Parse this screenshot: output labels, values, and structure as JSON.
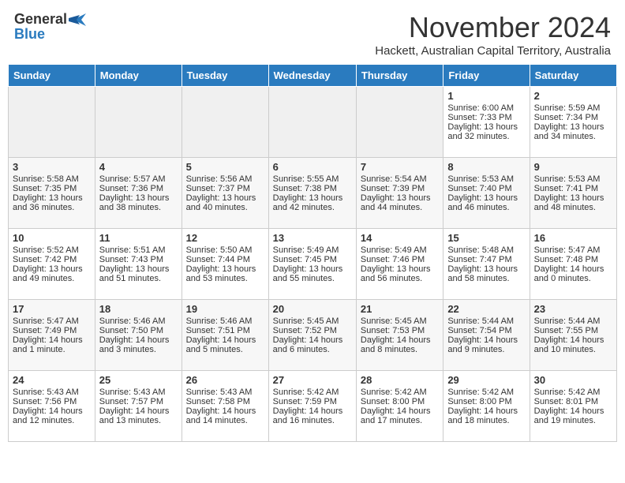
{
  "header": {
    "logo_general": "General",
    "logo_blue": "Blue",
    "month_title": "November 2024",
    "location": "Hackett, Australian Capital Territory, Australia"
  },
  "weekdays": [
    "Sunday",
    "Monday",
    "Tuesday",
    "Wednesday",
    "Thursday",
    "Friday",
    "Saturday"
  ],
  "weeks": [
    [
      {
        "day": "",
        "empty": true
      },
      {
        "day": "",
        "empty": true
      },
      {
        "day": "",
        "empty": true
      },
      {
        "day": "",
        "empty": true
      },
      {
        "day": "",
        "empty": true
      },
      {
        "day": "1",
        "sunrise": "Sunrise: 6:00 AM",
        "sunset": "Sunset: 7:33 PM",
        "daylight": "Daylight: 13 hours and 32 minutes."
      },
      {
        "day": "2",
        "sunrise": "Sunrise: 5:59 AM",
        "sunset": "Sunset: 7:34 PM",
        "daylight": "Daylight: 13 hours and 34 minutes."
      }
    ],
    [
      {
        "day": "3",
        "sunrise": "Sunrise: 5:58 AM",
        "sunset": "Sunset: 7:35 PM",
        "daylight": "Daylight: 13 hours and 36 minutes."
      },
      {
        "day": "4",
        "sunrise": "Sunrise: 5:57 AM",
        "sunset": "Sunset: 7:36 PM",
        "daylight": "Daylight: 13 hours and 38 minutes."
      },
      {
        "day": "5",
        "sunrise": "Sunrise: 5:56 AM",
        "sunset": "Sunset: 7:37 PM",
        "daylight": "Daylight: 13 hours and 40 minutes."
      },
      {
        "day": "6",
        "sunrise": "Sunrise: 5:55 AM",
        "sunset": "Sunset: 7:38 PM",
        "daylight": "Daylight: 13 hours and 42 minutes."
      },
      {
        "day": "7",
        "sunrise": "Sunrise: 5:54 AM",
        "sunset": "Sunset: 7:39 PM",
        "daylight": "Daylight: 13 hours and 44 minutes."
      },
      {
        "day": "8",
        "sunrise": "Sunrise: 5:53 AM",
        "sunset": "Sunset: 7:40 PM",
        "daylight": "Daylight: 13 hours and 46 minutes."
      },
      {
        "day": "9",
        "sunrise": "Sunrise: 5:53 AM",
        "sunset": "Sunset: 7:41 PM",
        "daylight": "Daylight: 13 hours and 48 minutes."
      }
    ],
    [
      {
        "day": "10",
        "sunrise": "Sunrise: 5:52 AM",
        "sunset": "Sunset: 7:42 PM",
        "daylight": "Daylight: 13 hours and 49 minutes."
      },
      {
        "day": "11",
        "sunrise": "Sunrise: 5:51 AM",
        "sunset": "Sunset: 7:43 PM",
        "daylight": "Daylight: 13 hours and 51 minutes."
      },
      {
        "day": "12",
        "sunrise": "Sunrise: 5:50 AM",
        "sunset": "Sunset: 7:44 PM",
        "daylight": "Daylight: 13 hours and 53 minutes."
      },
      {
        "day": "13",
        "sunrise": "Sunrise: 5:49 AM",
        "sunset": "Sunset: 7:45 PM",
        "daylight": "Daylight: 13 hours and 55 minutes."
      },
      {
        "day": "14",
        "sunrise": "Sunrise: 5:49 AM",
        "sunset": "Sunset: 7:46 PM",
        "daylight": "Daylight: 13 hours and 56 minutes."
      },
      {
        "day": "15",
        "sunrise": "Sunrise: 5:48 AM",
        "sunset": "Sunset: 7:47 PM",
        "daylight": "Daylight: 13 hours and 58 minutes."
      },
      {
        "day": "16",
        "sunrise": "Sunrise: 5:47 AM",
        "sunset": "Sunset: 7:48 PM",
        "daylight": "Daylight: 14 hours and 0 minutes."
      }
    ],
    [
      {
        "day": "17",
        "sunrise": "Sunrise: 5:47 AM",
        "sunset": "Sunset: 7:49 PM",
        "daylight": "Daylight: 14 hours and 1 minute."
      },
      {
        "day": "18",
        "sunrise": "Sunrise: 5:46 AM",
        "sunset": "Sunset: 7:50 PM",
        "daylight": "Daylight: 14 hours and 3 minutes."
      },
      {
        "day": "19",
        "sunrise": "Sunrise: 5:46 AM",
        "sunset": "Sunset: 7:51 PM",
        "daylight": "Daylight: 14 hours and 5 minutes."
      },
      {
        "day": "20",
        "sunrise": "Sunrise: 5:45 AM",
        "sunset": "Sunset: 7:52 PM",
        "daylight": "Daylight: 14 hours and 6 minutes."
      },
      {
        "day": "21",
        "sunrise": "Sunrise: 5:45 AM",
        "sunset": "Sunset: 7:53 PM",
        "daylight": "Daylight: 14 hours and 8 minutes."
      },
      {
        "day": "22",
        "sunrise": "Sunrise: 5:44 AM",
        "sunset": "Sunset: 7:54 PM",
        "daylight": "Daylight: 14 hours and 9 minutes."
      },
      {
        "day": "23",
        "sunrise": "Sunrise: 5:44 AM",
        "sunset": "Sunset: 7:55 PM",
        "daylight": "Daylight: 14 hours and 10 minutes."
      }
    ],
    [
      {
        "day": "24",
        "sunrise": "Sunrise: 5:43 AM",
        "sunset": "Sunset: 7:56 PM",
        "daylight": "Daylight: 14 hours and 12 minutes."
      },
      {
        "day": "25",
        "sunrise": "Sunrise: 5:43 AM",
        "sunset": "Sunset: 7:57 PM",
        "daylight": "Daylight: 14 hours and 13 minutes."
      },
      {
        "day": "26",
        "sunrise": "Sunrise: 5:43 AM",
        "sunset": "Sunset: 7:58 PM",
        "daylight": "Daylight: 14 hours and 14 minutes."
      },
      {
        "day": "27",
        "sunrise": "Sunrise: 5:42 AM",
        "sunset": "Sunset: 7:59 PM",
        "daylight": "Daylight: 14 hours and 16 minutes."
      },
      {
        "day": "28",
        "sunrise": "Sunrise: 5:42 AM",
        "sunset": "Sunset: 8:00 PM",
        "daylight": "Daylight: 14 hours and 17 minutes."
      },
      {
        "day": "29",
        "sunrise": "Sunrise: 5:42 AM",
        "sunset": "Sunset: 8:00 PM",
        "daylight": "Daylight: 14 hours and 18 minutes."
      },
      {
        "day": "30",
        "sunrise": "Sunrise: 5:42 AM",
        "sunset": "Sunset: 8:01 PM",
        "daylight": "Daylight: 14 hours and 19 minutes."
      }
    ]
  ]
}
